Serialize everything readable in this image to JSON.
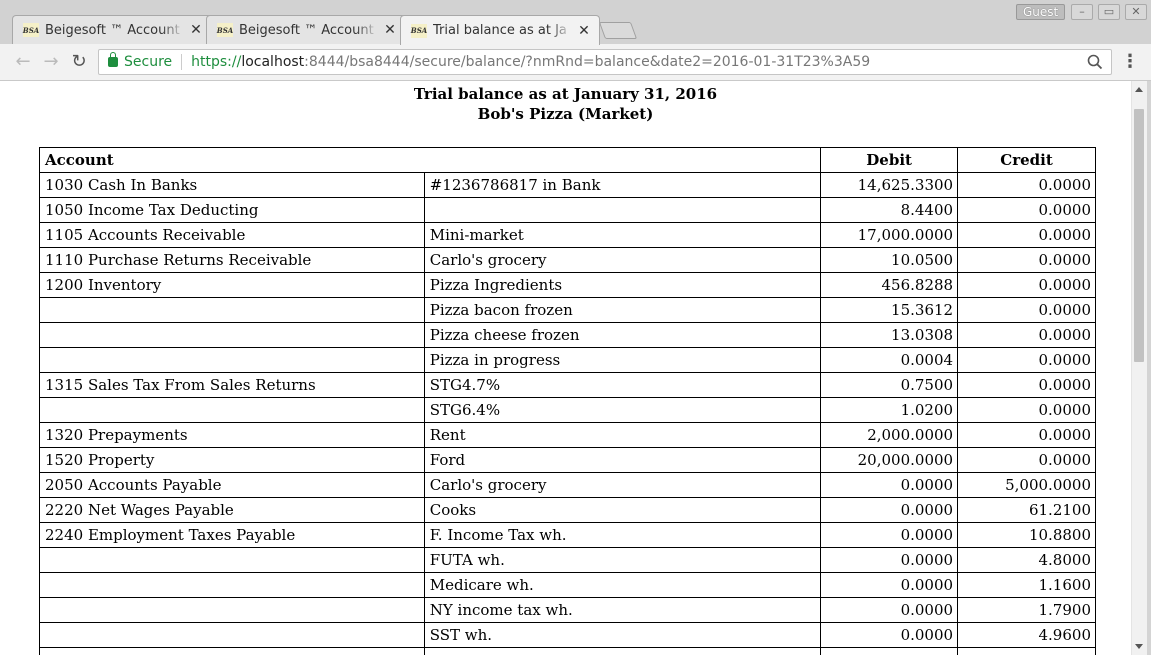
{
  "browser": {
    "tabs": [
      {
        "title": "Beigesoft ™ Account",
        "favicon": "BSA"
      },
      {
        "title": "Beigesoft ™ Account",
        "favicon": "BSA"
      },
      {
        "title": "Trial balance as at Ja",
        "favicon": "BSA"
      }
    ],
    "profile": "Guest",
    "secure_label": "Secure",
    "url_scheme": "https://",
    "url_host": "localhost",
    "url_rest": ":8444/bsa8444/secure/balance/?nmRnd=balance&date2=2016-01-31T23%3A59"
  },
  "report": {
    "title": "Trial balance as at January 31, 2016",
    "subtitle": "Bob's Pizza (Market)",
    "headers": {
      "account": "Account",
      "debit": "Debit",
      "credit": "Credit"
    },
    "rows": [
      {
        "account": "1030 Cash In Banks",
        "sub": "#1236786817 in Bank",
        "debit": "14,625.3300",
        "credit": "0.0000"
      },
      {
        "account": "1050 Income Tax Deducting",
        "sub": "",
        "debit": "8.4400",
        "credit": "0.0000"
      },
      {
        "account": "1105 Accounts Receivable",
        "sub": "Mini-market",
        "debit": "17,000.0000",
        "credit": "0.0000"
      },
      {
        "account": "1110 Purchase Returns Receivable",
        "sub": "Carlo's grocery",
        "debit": "10.0500",
        "credit": "0.0000"
      },
      {
        "account": "1200 Inventory",
        "sub": "Pizza Ingredients",
        "debit": "456.8288",
        "credit": "0.0000"
      },
      {
        "account": "",
        "sub": "Pizza bacon frozen",
        "debit": "15.3612",
        "credit": "0.0000"
      },
      {
        "account": "",
        "sub": "Pizza cheese frozen",
        "debit": "13.0308",
        "credit": "0.0000"
      },
      {
        "account": "",
        "sub": "Pizza in progress",
        "debit": "0.0004",
        "credit": "0.0000"
      },
      {
        "account": "1315 Sales Tax From Sales Returns",
        "sub": "STG4.7%",
        "debit": "0.7500",
        "credit": "0.0000"
      },
      {
        "account": "",
        "sub": "STG6.4%",
        "debit": "1.0200",
        "credit": "0.0000"
      },
      {
        "account": "1320 Prepayments",
        "sub": "Rent",
        "debit": "2,000.0000",
        "credit": "0.0000"
      },
      {
        "account": "1520 Property",
        "sub": "Ford",
        "debit": "20,000.0000",
        "credit": "0.0000"
      },
      {
        "account": "2050 Accounts Payable",
        "sub": "Carlo's grocery",
        "debit": "0.0000",
        "credit": "5,000.0000"
      },
      {
        "account": "2220 Net Wages Payable",
        "sub": "Cooks",
        "debit": "0.0000",
        "credit": "61.2100"
      },
      {
        "account": "2240 Employment Taxes Payable",
        "sub": "F. Income Tax wh.",
        "debit": "0.0000",
        "credit": "10.8800"
      },
      {
        "account": "",
        "sub": "FUTA wh.",
        "debit": "0.0000",
        "credit": "4.8000"
      },
      {
        "account": "",
        "sub": "Medicare wh.",
        "debit": "0.0000",
        "credit": "1.1600"
      },
      {
        "account": "",
        "sub": "NY income tax wh.",
        "debit": "0.0000",
        "credit": "1.7900"
      },
      {
        "account": "",
        "sub": "SST wh.",
        "debit": "0.0000",
        "credit": "4.9600"
      },
      {
        "account": "",
        "sub": "",
        "debit": "",
        "credit": ""
      }
    ]
  }
}
